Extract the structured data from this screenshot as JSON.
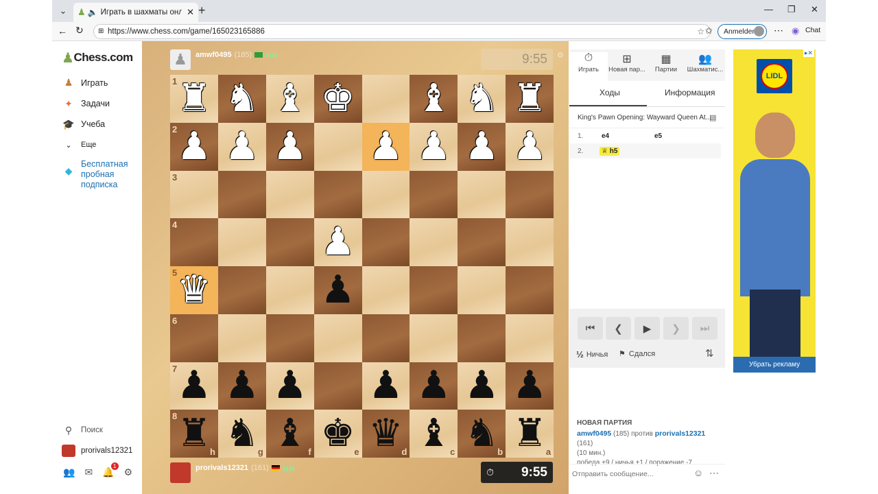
{
  "browser": {
    "tab_title": "Играть в шахматы онлайн Бе",
    "url": "https://www.chess.com/game/165023165886",
    "sign_in_label": "Anmelden",
    "chat_label": "Chat"
  },
  "sidebar": {
    "logo": "Chess.com",
    "items": [
      {
        "label": "Играть",
        "icon": "pawn-hand-icon"
      },
      {
        "label": "Задачи",
        "icon": "puzzle-icon"
      },
      {
        "label": "Учеба",
        "icon": "graduation-cap-icon"
      },
      {
        "label": "Еще",
        "icon": "chevron-down-icon"
      }
    ],
    "trial_label": "Бесплатная пробная подписка",
    "search_label": "Поиск",
    "username": "prorivals12321",
    "notification_count": "1"
  },
  "game": {
    "top_player": {
      "name": "amwf0495",
      "rating": "(185)",
      "clock": "9:55"
    },
    "bottom_player": {
      "name": "prorivals12321",
      "rating": "(161)",
      "clock": "9:55"
    },
    "ranks": [
      "1",
      "2",
      "3",
      "4",
      "5",
      "6",
      "7",
      "8"
    ],
    "files": [
      "h",
      "g",
      "f",
      "e",
      "d",
      "c",
      "b",
      "a"
    ],
    "board": [
      [
        "wR",
        "wN",
        "wB",
        "wK",
        "",
        "wB",
        "wN",
        "wR"
      ],
      [
        "wP",
        "wP",
        "wP",
        "",
        "wP",
        "wP",
        "wP",
        "wP"
      ],
      [
        "",
        "",
        "",
        "",
        "",
        "",
        "",
        ""
      ],
      [
        "",
        "",
        "",
        "wP",
        "",
        "",
        "",
        ""
      ],
      [
        "wQ",
        "",
        "",
        "bP",
        "",
        "",
        "",
        ""
      ],
      [
        "",
        "",
        "",
        "",
        "",
        "",
        "",
        ""
      ],
      [
        "bP",
        "bP",
        "bP",
        "",
        "bP",
        "bP",
        "bP",
        "bP"
      ],
      [
        "bR",
        "bN",
        "bB",
        "bK",
        "bQ",
        "bB",
        "bN",
        "bR"
      ]
    ],
    "highlights": [
      "1,4",
      "4,0"
    ]
  },
  "panel": {
    "tabs": [
      {
        "label": "Играть",
        "icon": "stopwatch-icon"
      },
      {
        "label": "Новая пар...",
        "icon": "plus-square-icon"
      },
      {
        "label": "Партии",
        "icon": "chessboard-icon"
      },
      {
        "label": "Шахматис...",
        "icon": "players-icon"
      }
    ],
    "subtabs": {
      "moves": "Ходы",
      "info": "Информация"
    },
    "opening": "King's Pawn Opening: Wayward Queen At...",
    "moves": [
      {
        "num": "1.",
        "white": "e4",
        "black": "e5"
      },
      {
        "num": "2.",
        "white": "h5",
        "black": ""
      }
    ],
    "draw_label": "Ничья",
    "draw_fraction": "½",
    "resign_label": "Сдался",
    "new_game": {
      "title": "НОВАЯ ПАРТИЯ",
      "player1": "amwf0495",
      "rating1": "(185)",
      "vs": "против",
      "player2": "prorivals12321",
      "rating2": "(161)",
      "time_control": "(10 мин.)",
      "results": "победа +9 / ничья +1 / поражение -7"
    },
    "message_placeholder": "Отправить сообщение..."
  },
  "ad": {
    "brand": "LIDL",
    "remove_label": "Убрать рекламу"
  }
}
